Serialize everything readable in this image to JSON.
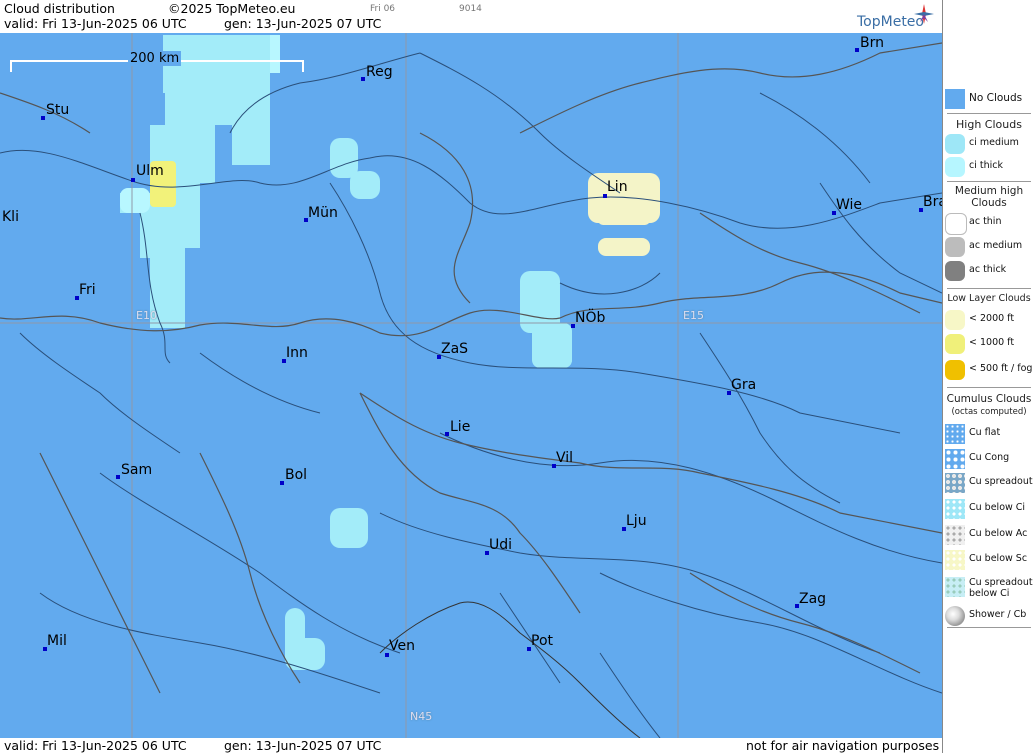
{
  "header": {
    "title": "Cloud distribution",
    "copyright": "©2025 TopMeteo.eu",
    "day_tab": "Fri 06",
    "code": "9014",
    "valid": "valid:  Fri  13-Jun-2025  06 UTC",
    "generated": "gen: 13-Jun-2025 07 UTC",
    "brand": "TopMeteo"
  },
  "scale": {
    "label": "200 km"
  },
  "grid_labels": {
    "e10": "E10",
    "e15": "E15",
    "n45": "N45"
  },
  "cities": {
    "brn": "Brn",
    "reg": "Reg",
    "stu": "Stu",
    "ulm": "Ulm",
    "kli": "Kli",
    "mun": "Mün",
    "lin": "Lin",
    "wie": "Wie",
    "bra": "Bra",
    "fri": "Fri",
    "nob": "NÖb",
    "inn": "Inn",
    "zas": "ZaS",
    "gra": "Gra",
    "lie": "Lie",
    "sam": "Sam",
    "bol": "Bol",
    "vil": "Vil",
    "lju": "Lju",
    "udi": "Udi",
    "zag": "Zag",
    "mil": "Mil",
    "ven": "Ven",
    "pot": "Pot"
  },
  "footer": {
    "valid": "valid:  Fri  13-Jun-2025  06 UTC",
    "generated": "gen: 13-Jun-2025 07 UTC",
    "disclaimer": "not for air navigation purposes"
  },
  "legend": {
    "no_clouds": "No Clouds",
    "high_title": "High Clouds",
    "ci_medium": "ci medium",
    "ci_thick": "ci thick",
    "medium_title": "Medium high Clouds",
    "ac_thin": "ac thin",
    "ac_medium": "ac medium",
    "ac_thick": "ac thick",
    "low_title": "Low Layer Clouds",
    "low_2000": "< 2000 ft",
    "low_1000": "< 1000 ft",
    "low_500": "< 500 ft / fog",
    "cu_title": "Cumulus Clouds",
    "cu_sub": "(octas computed)",
    "cu_flat": "Cu flat",
    "cu_cong": "Cu Cong",
    "cu_spread": "Cu spreadout",
    "cu_below_ci": "Cu below Ci",
    "cu_below_ac": "Cu below Ac",
    "cu_below_sc": "Cu below Sc",
    "cu_spread_ci": "Cu spreadout below Ci",
    "shower": "Shower / Cb"
  },
  "colors": {
    "no_clouds": "#62aaee",
    "ci_medium": "#9ee7f7",
    "ci_thick": "#b6f6ff",
    "low_2000": "#f7f7c7",
    "low_1000": "#f0f07a",
    "low_500": "#f0c000"
  }
}
